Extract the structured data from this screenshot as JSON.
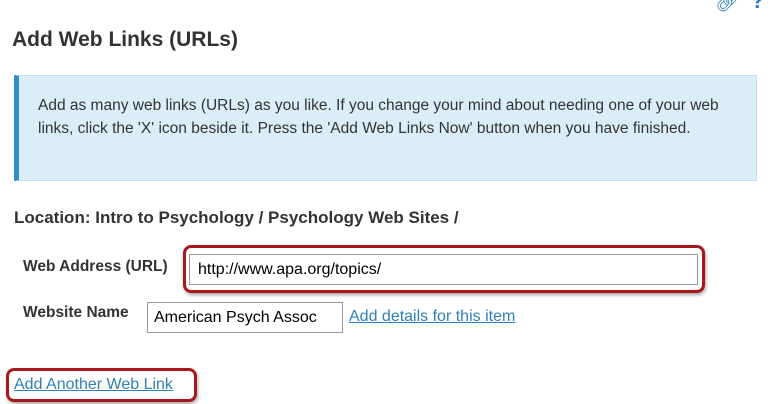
{
  "page_title": "Add Web Links (URLs)",
  "info": {
    "message": "Add as many web links (URLs) as you like. If you change your mind about needing one of your web links, click the 'X' icon beside it. Press the 'Add Web Links Now' button when you have finished."
  },
  "location": "Location: Intro to Psychology / Psychology Web Sites /",
  "form": {
    "url_label": "Web Address (URL)",
    "url_value": "http://www.apa.org/topics/",
    "name_label": "Website Name",
    "name_value": "American Psych Assoc",
    "details_link": "Add details for this item"
  },
  "add_another_link": "Add Another Web Link",
  "icons": {
    "top_left": "link-icon",
    "top_right": "help-icon"
  },
  "colors": {
    "link": "#2f7fb5",
    "highlight": "#a5191e",
    "info_bg": "#dbedf6",
    "info_border": "#2f8fcc"
  }
}
